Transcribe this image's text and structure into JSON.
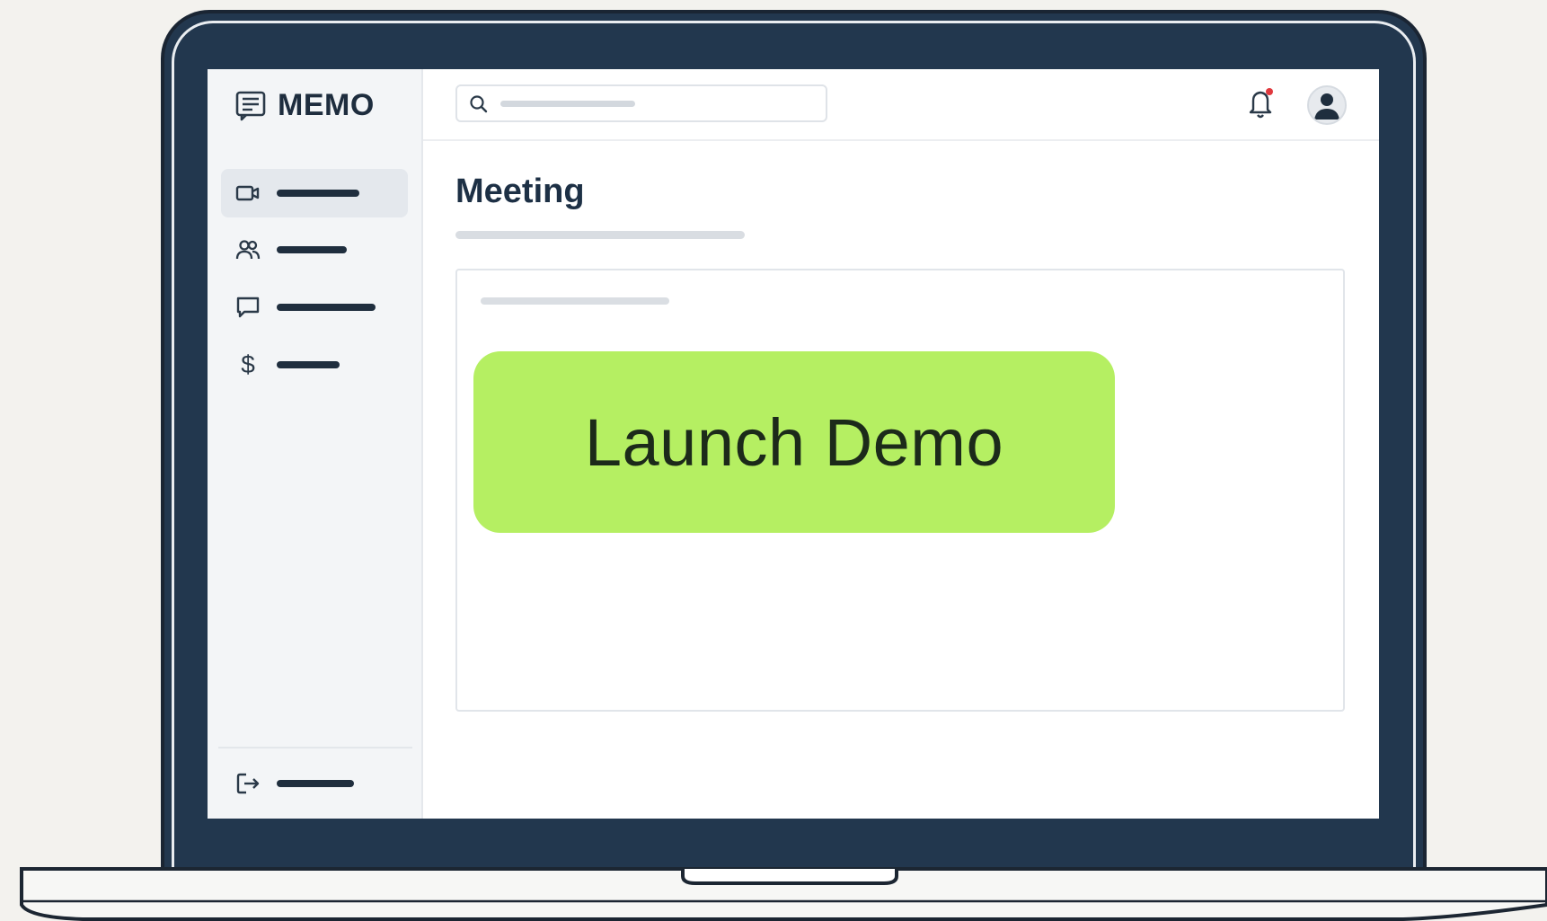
{
  "app": {
    "brand_name": "MEMO",
    "brand_icon": "memo-note-icon"
  },
  "search": {
    "icon": "search-icon",
    "placeholder": ""
  },
  "header": {
    "notification_icon": "bell-icon",
    "notification_unread": true,
    "avatar_icon": "user-avatar-icon"
  },
  "sidebar": {
    "items": [
      {
        "icon": "video-camera-icon",
        "label": "",
        "active": true
      },
      {
        "icon": "people-icon",
        "label": "",
        "active": false
      },
      {
        "icon": "chat-bubble-icon",
        "label": "",
        "active": false
      },
      {
        "icon": "dollar-icon",
        "label": "$",
        "active": false
      }
    ],
    "footer_item": {
      "icon": "logout-icon",
      "label": ""
    }
  },
  "main": {
    "page_title": "Meeting",
    "card": {
      "primary_button_label": "Launch Demo"
    }
  },
  "colors": {
    "frame": "#22374e",
    "accent_button": "#b5ef62",
    "title_text": "#1d3045",
    "notification_dot": "#e0393e",
    "sidebar_bg": "#f3f5f7"
  }
}
